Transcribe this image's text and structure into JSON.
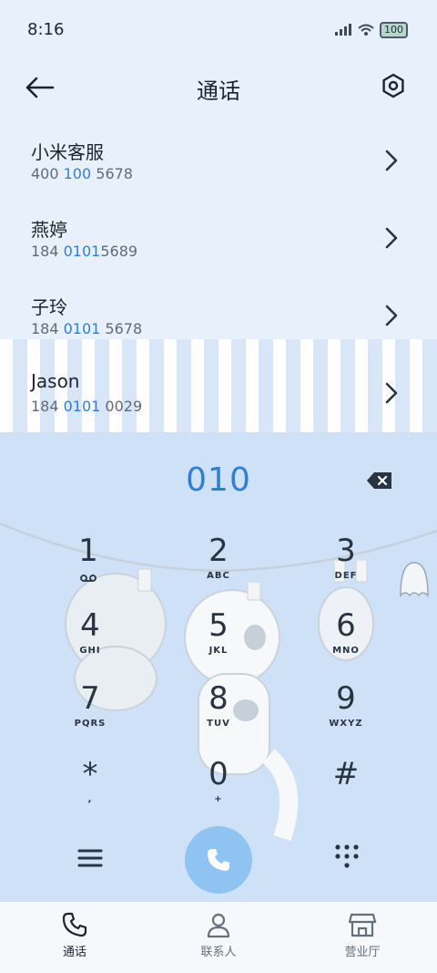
{
  "status": {
    "time": "8:16",
    "battery": "100"
  },
  "header": {
    "title": "通话"
  },
  "contacts": [
    {
      "name": "小米客服",
      "num_pre": "400 ",
      "num_hl": "100",
      "num_post": " 5678"
    },
    {
      "name": "燕婷",
      "num_pre": "184 ",
      "num_hl": "0101",
      "num_post": "5689"
    },
    {
      "name": "子玲",
      "num_pre": "184 ",
      "num_hl": "0101",
      "num_post": " 5678"
    },
    {
      "name": "Jason",
      "num_pre": "184 ",
      "num_hl": "0101",
      "num_post": " 0029"
    }
  ],
  "dialpad": {
    "input": "010",
    "keys": [
      {
        "digit": "1",
        "letters": ""
      },
      {
        "digit": "2",
        "letters": "ABC"
      },
      {
        "digit": "3",
        "letters": "DEF"
      },
      {
        "digit": "4",
        "letters": "GHI"
      },
      {
        "digit": "5",
        "letters": "JKL"
      },
      {
        "digit": "6",
        "letters": "MNO"
      },
      {
        "digit": "7",
        "letters": "PQRS"
      },
      {
        "digit": "8",
        "letters": "TUV"
      },
      {
        "digit": "9",
        "letters": "WXYZ"
      },
      {
        "digit": "*",
        "letters": ","
      },
      {
        "digit": "0",
        "letters": "+"
      },
      {
        "digit": "#",
        "letters": ""
      }
    ]
  },
  "nav": [
    {
      "label": "通话",
      "icon": "phone-icon"
    },
    {
      "label": "联系人",
      "icon": "person-icon"
    },
    {
      "label": "营业厅",
      "icon": "store-icon"
    }
  ],
  "colors": {
    "accent": "#2f7fd3",
    "call_button": "#8fc3f1"
  }
}
